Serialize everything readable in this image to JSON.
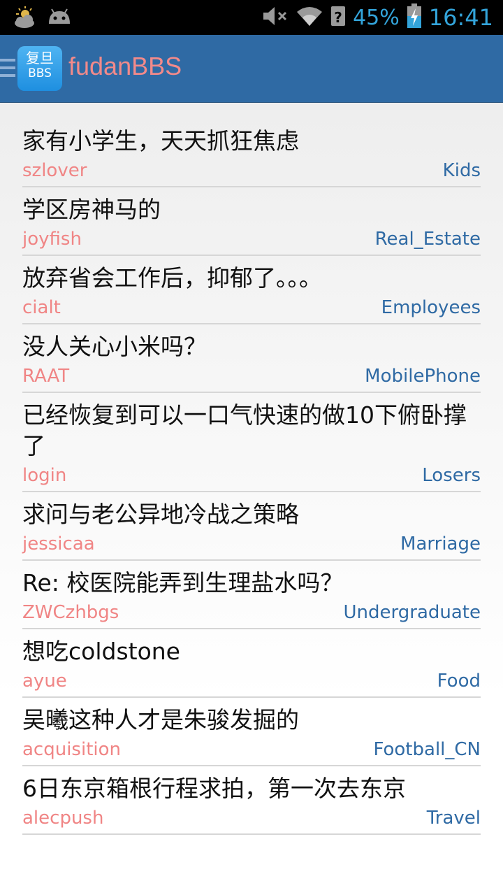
{
  "status_bar": {
    "battery": "45%",
    "time": "16:41",
    "icons": [
      "weather-icon",
      "android-icon",
      "mute-icon",
      "wifi-icon",
      "signal-icon",
      "battery-charging-icon"
    ]
  },
  "app": {
    "logo_line1": "复旦",
    "logo_line2": "BBS",
    "title": "fudanBBS"
  },
  "posts": [
    {
      "title": "家有小学生，天天抓狂焦虑",
      "author": "szlover",
      "board": "Kids"
    },
    {
      "title": "学区房神马的",
      "author": "joyfish",
      "board": "Real_Estate"
    },
    {
      "title": "放弃省会工作后，抑郁了。。。",
      "author": "cialt",
      "board": "Employees"
    },
    {
      "title": "没人关心小米吗？",
      "author": "RAAT",
      "board": "MobilePhone"
    },
    {
      "title": "已经恢复到可以一口气快速的做10下俯卧撑了",
      "author": "login",
      "board": "Losers"
    },
    {
      "title": "求问与老公异地冷战之策略",
      "author": "jessicaa",
      "board": "Marriage"
    },
    {
      "title": "Re: 校医院能弄到生理盐水吗？",
      "author": "ZWCzhbgs",
      "board": "Undergraduate"
    },
    {
      "title": "想吃coldstone",
      "author": "ayue",
      "board": "Food"
    },
    {
      "title": "吴曦这种人才是朱骏发掘的",
      "author": "acquisition",
      "board": "Football_CN"
    },
    {
      "title": "6日东京箱根行程求拍，第一次去东京",
      "author": "alecpush",
      "board": "Travel"
    }
  ],
  "colors": {
    "action_bar": "#2f6aa4",
    "author": "#f08585",
    "board": "#2f6aa4",
    "status_accent": "#33a4da"
  }
}
